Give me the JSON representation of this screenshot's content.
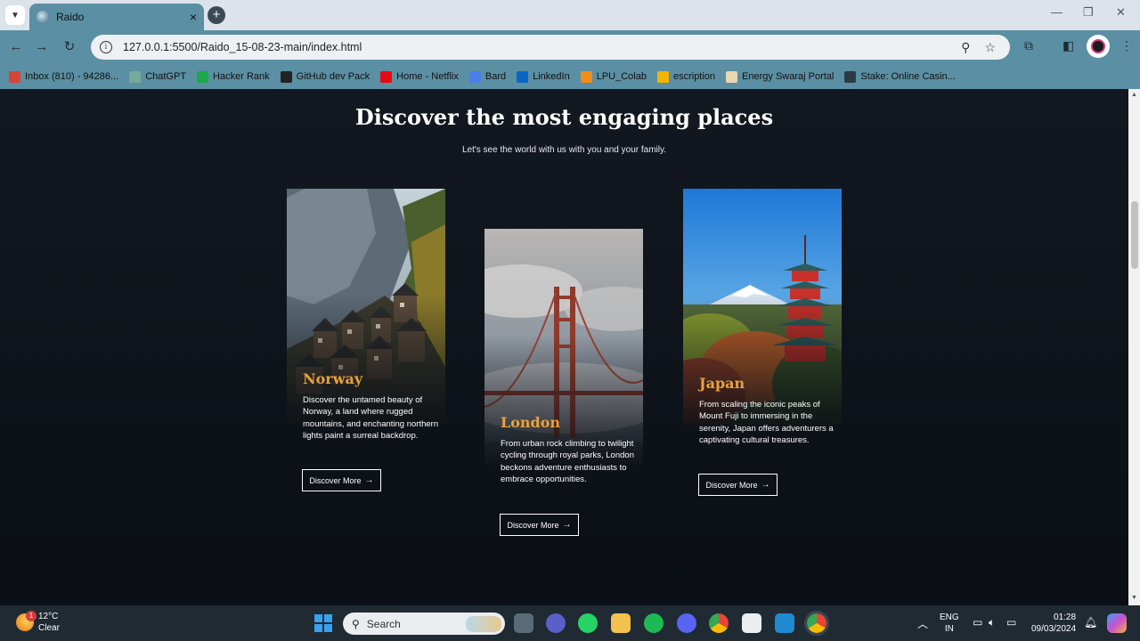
{
  "browser": {
    "tab_title": "Raido",
    "tab_close": "×",
    "new_tab": "+",
    "url": "127.0.0.1:5500/Raido_15-08-23-main/index.html",
    "window_controls": [
      "—",
      "❐",
      "✕"
    ]
  },
  "bookmarks": [
    {
      "label": "Inbox (810) - 94286...",
      "color": "#d44638"
    },
    {
      "label": "ChatGPT",
      "color": "#74aa9c"
    },
    {
      "label": "Hacker Rank",
      "color": "#1ba94c"
    },
    {
      "label": "GitHub dev Pack",
      "color": "#222222"
    },
    {
      "label": "Home - Netflix",
      "color": "#e50914"
    },
    {
      "label": "Bard",
      "color": "#4a7de8"
    },
    {
      "label": "LinkedIn",
      "color": "#0a66c2"
    },
    {
      "label": "LPU_Colab",
      "color": "#f28c1b"
    },
    {
      "label": "escription",
      "color": "#f5b400"
    },
    {
      "label": "Energy Swaraj Portal",
      "color": "#e8d7b0"
    },
    {
      "label": "Stake: Online Casin...",
      "color": "#2a3b47"
    }
  ],
  "section": {
    "heading": "Discover the most engaging places",
    "subheading": "Let's see the world with us with you and your family."
  },
  "cards": [
    {
      "name": "Norway",
      "description": "Discover the untamed beauty of Norway, a land where rugged mountains, and enchanting northern lights paint a surreal backdrop.",
      "button": "Discover More"
    },
    {
      "name": "London",
      "description": "From urban rock climbing to twilight cycling through royal parks, London beckons adventure enthusiasts to embrace opportunities.",
      "button": "Discover More"
    },
    {
      "name": "Japan",
      "description": "From scaling the iconic peaks of Mount Fuji to immersing in the serenity, Japan offers adventurers a captivating cultural treasures.",
      "button": "Discover More"
    }
  ],
  "taskbar": {
    "weather_temp": "12°C",
    "weather_desc": "Clear",
    "weather_badge": "1",
    "search_placeholder": "Search",
    "lang_top": "ENG",
    "lang_bottom": "IN",
    "time": "01:28",
    "date": "09/03/2024"
  },
  "colors": {
    "accent": "#e8a33c",
    "page_bg": "#0f1319",
    "browser_frame": "#5b8fa3"
  }
}
